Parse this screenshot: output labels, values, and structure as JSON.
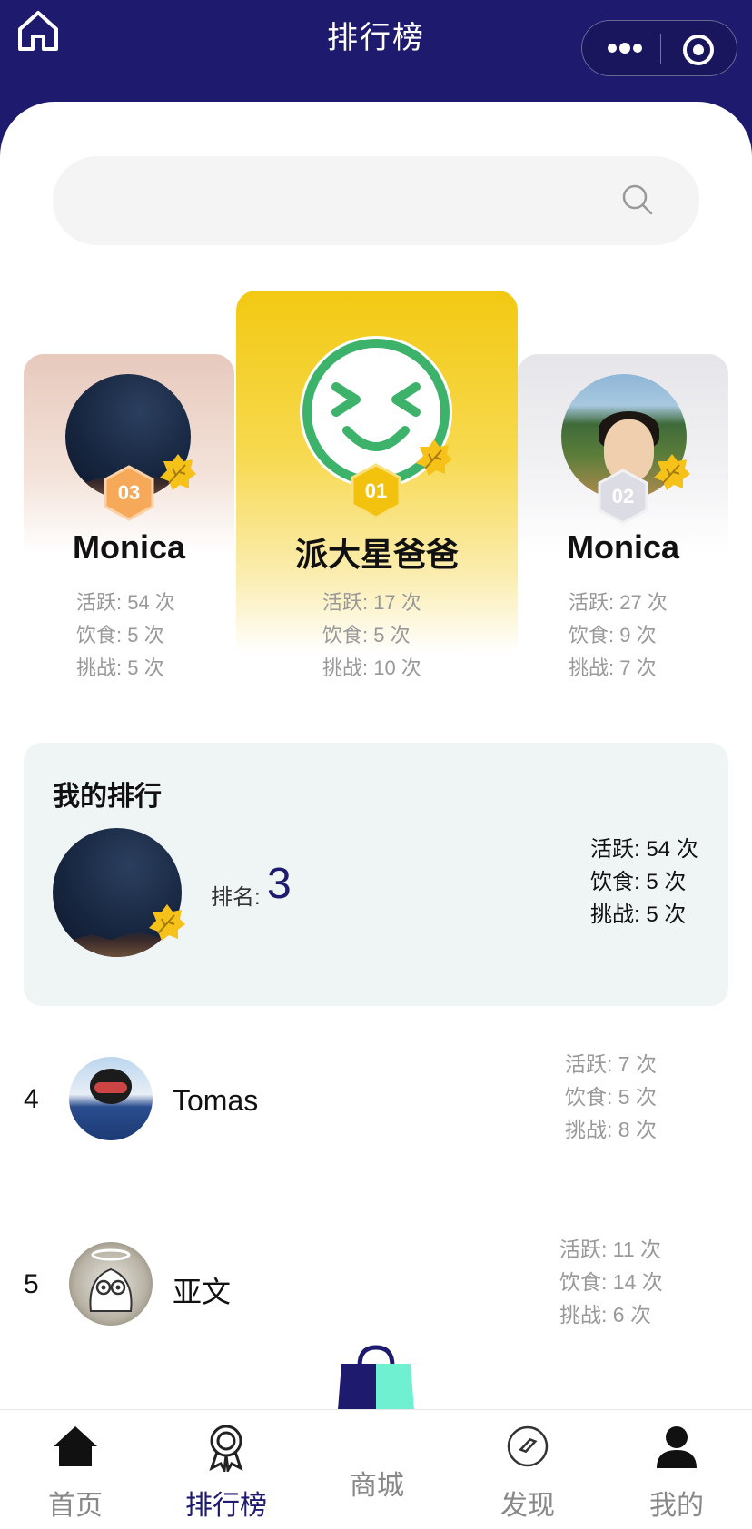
{
  "header": {
    "title": "排行榜"
  },
  "search": {
    "placeholder": ""
  },
  "podium": {
    "left": {
      "rank_badge": "03",
      "name": "Monica",
      "stats": [
        "活跃: 54 次",
        "饮食: 5 次",
        "挑战: 5 次"
      ]
    },
    "center": {
      "rank_badge": "01",
      "name": "派大星爸爸",
      "stats": [
        "活跃: 17 次",
        "饮食: 5 次",
        "挑战: 10 次"
      ]
    },
    "right": {
      "rank_badge": "02",
      "name": "Monica",
      "stats": [
        "活跃: 27 次",
        "饮食: 9 次",
        "挑战: 7 次"
      ]
    }
  },
  "my_rank": {
    "heading": "我的排行",
    "rank_label": "排名:",
    "rank_value": "3",
    "stats": [
      "活跃: 54 次",
      "饮食: 5 次",
      "挑战: 5 次"
    ]
  },
  "list": [
    {
      "rank": "4",
      "name": "Tomas",
      "stats": [
        "活跃: 7 次",
        "饮食: 5 次",
        "挑战: 8 次"
      ]
    },
    {
      "rank": "5",
      "name": "亚文",
      "stats": [
        "活跃: 11 次",
        "饮食: 14 次",
        "挑战: 6 次"
      ]
    }
  ],
  "nav": {
    "items": [
      {
        "label": "首页",
        "icon": "home-icon"
      },
      {
        "label": "排行榜",
        "icon": "ribbon-icon"
      },
      {
        "label": "商城",
        "icon": "shopping-bag-icon"
      },
      {
        "label": "发现",
        "icon": "compass-icon"
      },
      {
        "label": "我的",
        "icon": "user-icon"
      }
    ],
    "active_index": 1
  },
  "colors": {
    "primary": "#1e1a6e",
    "gold": "#f2c912",
    "accent_mint": "#6ff0d0"
  }
}
